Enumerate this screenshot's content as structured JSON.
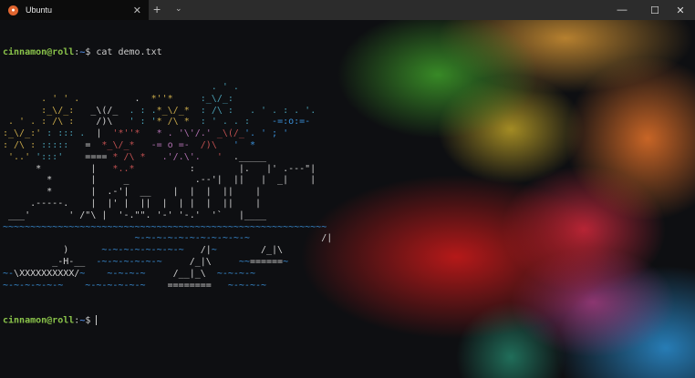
{
  "window": {
    "tab_title": "Ubuntu",
    "tab_icon": "ubuntu-logo-icon",
    "new_tab": "+",
    "dropdown": "⌄",
    "minimize": "—",
    "maximize": "☐",
    "close": "✕",
    "tab_close": "✕"
  },
  "colors": {
    "w": "#d0d0d0",
    "y": "#c9a94a",
    "c": "#4aa0b5",
    "r": "#c05050",
    "m": "#b070b0",
    "bl": "#3a8fd8",
    "gr": "#888888"
  },
  "terminal": {
    "prompt_user": "cinnamon@roll",
    "prompt_sep": ":",
    "prompt_path": "~",
    "prompt_dollar": "$ ",
    "command": "cat demo.txt",
    "art": [
      [
        [
          "                                      . ' .",
          "c"
        ]
      ],
      [
        [
          "       . ' ' .",
          "y"
        ],
        [
          "          .",
          "w"
        ],
        [
          "  *''*",
          "y"
        ],
        [
          "     :_\\/_:",
          "c"
        ]
      ],
      [
        [
          "       :_\\/_:",
          "y"
        ],
        [
          "   _\\(/_",
          "w"
        ],
        [
          "  . : .",
          "c"
        ],
        [
          "*_\\/_*",
          "y"
        ],
        [
          "  : /\\ :",
          "c"
        ],
        [
          "   . ' . : . '.",
          "c"
        ]
      ],
      [
        [
          " . ' . : /\\ :",
          "y"
        ],
        [
          "    /)\\",
          "w"
        ],
        [
          "   ' : '",
          "c"
        ],
        [
          "* /\\ *",
          "y"
        ],
        [
          "  : ' . . :",
          "c"
        ],
        [
          "    -=:o:=-",
          "bl"
        ]
      ],
      [
        [
          ":_\\/_:' ",
          "y"
        ],
        [
          ": ::: .",
          "c"
        ],
        [
          "  |",
          "w"
        ],
        [
          "  '*''*",
          "r"
        ],
        [
          "   * . '\\'/.' ",
          "m"
        ],
        [
          "_\\(/_",
          "r"
        ],
        [
          "'. ' ; '",
          "bl"
        ]
      ],
      [
        [
          ": /\\ : ",
          "y"
        ],
        [
          ":::::",
          "c"
        ],
        [
          "   =",
          "w"
        ],
        [
          "  *_\\/_*",
          "r"
        ],
        [
          "   -= o =- ",
          "m"
        ],
        [
          " /)\\ ",
          "r"
        ],
        [
          "  '  *",
          "bl"
        ]
      ],
      [
        [
          " '..' ",
          "y"
        ],
        [
          "':::' ",
          "c"
        ],
        [
          "   ====",
          "w"
        ],
        [
          " * /\\ *",
          "r"
        ],
        [
          "   .'/.\\'. ",
          "m"
        ],
        [
          "  ' ",
          "r"
        ],
        [
          " ._____",
          "w"
        ]
      ],
      [
        [
          "      *         |   ",
          "w"
        ],
        [
          "*..*",
          "r"
        ],
        [
          "          :        |.   |' .---\"|",
          "w"
        ]
      ],
      [
        [
          "        *       |     _            .--'|  ||   |  _|    |",
          "w"
        ]
      ],
      [
        [
          "        *       |  .-'|  __    |  |  |  ||    |",
          "w"
        ]
      ],
      [
        [
          "     .-----.    |  |' |  ||  |  | |  |  ||    |",
          "w"
        ]
      ],
      [
        [
          " ___'       ' /\"\\ |  '-.\"\". '-' '-.'  '`   |____",
          "w"
        ]
      ],
      [
        [
          "~~~~~~~~~~~~~~~~~~~~~~~~~~~~~~~~~~~~~~~~~~~~~~~~~~~~~~~~~~~",
          "bl"
        ]
      ],
      [
        [
          "                        ~-~-~-~-~-~-~-~-~-~-~  ",
          "bl"
        ],
        [
          "           /|",
          "w"
        ]
      ],
      [
        [
          "           )      ",
          "w"
        ],
        [
          "~-~-~-~-~-~-~-~ ",
          "bl"
        ],
        [
          "  /|",
          "w"
        ],
        [
          "~",
          "bl"
        ],
        [
          "        /_|\\",
          "w"
        ]
      ],
      [
        [
          "         _-H-__ ",
          "w"
        ],
        [
          " -~-~-~-~-~-~ ",
          "bl"
        ],
        [
          "    /_|\\ ",
          "w"
        ],
        [
          "    ~~",
          "bl"
        ],
        [
          "======",
          "w"
        ],
        [
          "~",
          "bl"
        ]
      ],
      [
        [
          "~-",
          "bl"
        ],
        [
          "\\XXXXXXXXXX/",
          "w"
        ],
        [
          "~",
          "bl"
        ],
        [
          "    ~-~-~-~   ",
          "bl"
        ],
        [
          "  /__|_\\",
          "w"
        ],
        [
          "  ~-~-~-~",
          "bl"
        ]
      ],
      [
        [
          "~-~-~-~-~-~    ~-~-~-~-~-~   ",
          "bl"
        ],
        [
          " ========",
          "w"
        ],
        [
          "   ~-~-~-~",
          "bl"
        ]
      ]
    ]
  }
}
